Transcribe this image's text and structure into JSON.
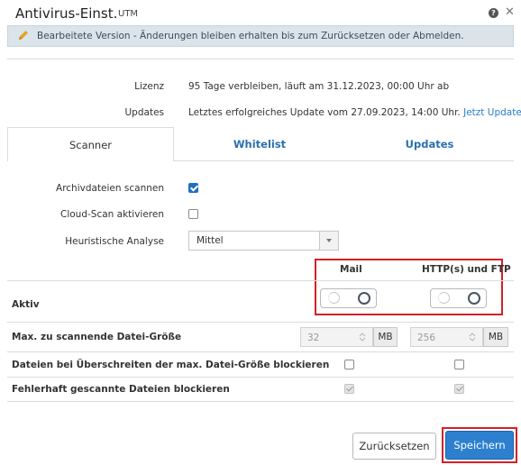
{
  "header": {
    "title": "Antivirus-Einst.",
    "subtitle": "UTM",
    "help_icon": "help-icon",
    "close_icon": "close-icon"
  },
  "notice": {
    "icon": "pencil-icon",
    "text": "Bearbeitete Version - Änderungen bleiben erhalten bis zum Zurücksetzen oder Abmelden."
  },
  "info": {
    "license_label": "Lizenz",
    "license_value": "95 Tage verbleiben, läuft am 31.12.2023, 00:00 Uhr ab",
    "updates_label": "Updates",
    "updates_value": "Letztes erfolgreiches Update vom 27.09.2023, 14:00 Uhr.",
    "updates_link": "Jetzt Updaten."
  },
  "tabs": [
    {
      "label": "Scanner",
      "active": true
    },
    {
      "label": "Whitelist",
      "active": false
    },
    {
      "label": "Updates",
      "active": false
    }
  ],
  "scanner": {
    "archive_label": "Archivdateien scannen",
    "archive_checked": true,
    "cloud_label": "Cloud-Scan aktivieren",
    "cloud_checked": false,
    "heuristic_label": "Heuristische Analyse",
    "heuristic_value": "Mittel"
  },
  "table": {
    "col_mail": "Mail",
    "col_http": "HTTP(s) und FTP",
    "rows": {
      "active_label": "Aktiv",
      "max_size_label": "Max. zu scannende Datei-Größe",
      "max_size_mail": "32",
      "max_size_http": "256",
      "unit": "MB",
      "block_oversize_label": "Dateien bei Überschreiten der max. Datei-Größe blockieren",
      "block_error_label": "Fehlerhaft gescannte Dateien blockieren"
    }
  },
  "buttons": {
    "reset": "Zurücksetzen",
    "save": "Speichern"
  },
  "colors": {
    "primary": "#2d80cf",
    "link": "#2a7cc7",
    "highlight": "#d32027",
    "notice_bg": "#dbe4ea"
  }
}
